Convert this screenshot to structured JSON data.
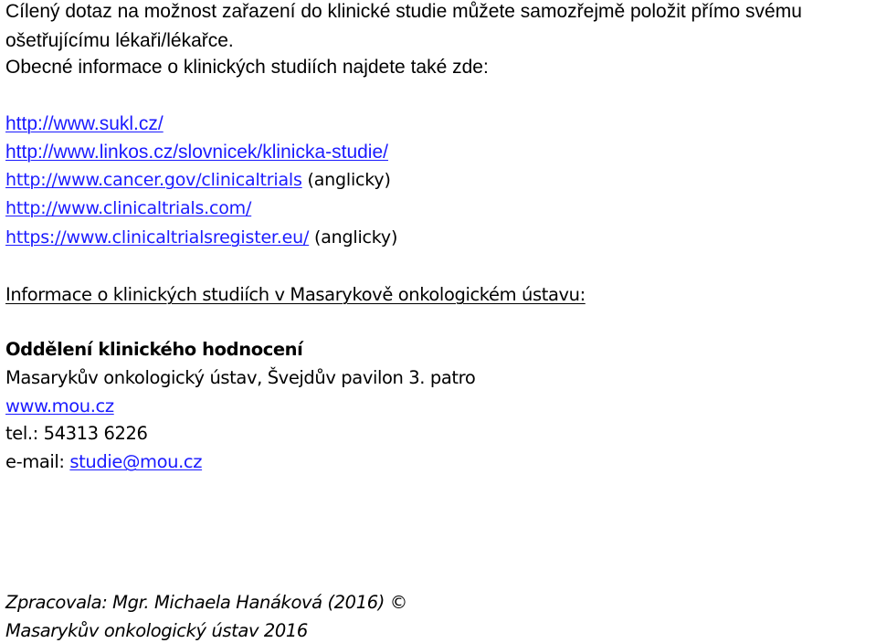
{
  "intro": {
    "line1": "Cílený dotaz na možnost zařazení do klinické studie můžete samozřejmě položit přímo svému",
    "line2": "ošetřujícímu lékaři/lékařce.",
    "line3": "Obecné informace o klinických studiích najdete také zde:"
  },
  "links": [
    {
      "url": "http://www.sukl.cz/",
      "note": ""
    },
    {
      "url": "http://www.linkos.cz/slovnicek/klinicka-studie/",
      "note": ""
    },
    {
      "url": "http://www.cancer.gov/clinicaltrials",
      "note": "(anglicky)"
    },
    {
      "url": "http://www.clinicaltrials.com/",
      "note": ""
    },
    {
      "url": "https://www.clinicaltrialsregister.eu/",
      "note": "(anglicky)"
    }
  ],
  "mou_heading": "Informace o klinických studiích v Masarykově onkologickém ústavu:",
  "department": {
    "name": "Oddělení klinického hodnocení",
    "address": "Masarykův onkologický ústav, Švejdův pavilon 3. patro",
    "web": "www.mou.cz",
    "phone": "tel.: 54313 6226",
    "email_label": "e-mail: ",
    "email": "studie@mou.cz"
  },
  "footer": {
    "author": "Zpracovala: Mgr. Michaela Hanáková (2016) ©",
    "org": "Masarykův onkologický ústav 2016"
  },
  "colors": {
    "link": "#1a1aff",
    "text": "#000000"
  }
}
